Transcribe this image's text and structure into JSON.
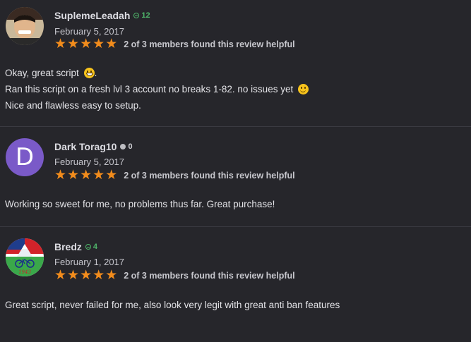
{
  "reviews": [
    {
      "username": "SuplemeLeadah",
      "rep": "12",
      "rep_type": "positive",
      "date": "February 5, 2017",
      "stars": 5,
      "helpful": "2 of 3 members found this review helpful",
      "avatar_letter": "",
      "body_lines": [
        "Okay, great script",
        "Ran this script on a fresh lvl 3 account no breaks 1-82. no issues yet",
        "Nice and flawless easy to setup."
      ]
    },
    {
      "username": "Dark Torag10",
      "rep": "0",
      "rep_type": "neutral",
      "date": "February 5, 2017",
      "stars": 5,
      "helpful": "2 of 3 members found this review helpful",
      "avatar_letter": "D",
      "body_lines": [
        "Working so sweet for me, no problems thus far. Great purchase!"
      ]
    },
    {
      "username": "Bredz",
      "rep": "4",
      "rep_type": "positive",
      "date": "February 1, 2017",
      "stars": 5,
      "helpful": "2 of 3 members found this review helpful",
      "avatar_letter": "",
      "body_lines": [
        "Great script, never failed for me, also look very legit with great anti ban features"
      ]
    }
  ],
  "colors": {
    "background": "#26262b",
    "star": "#f28c1c",
    "rep_positive": "#4fb56a",
    "avatar_d": "#7a5ac8"
  },
  "icons": [
    "star-icon",
    "reputation-icon",
    "grin-emoji-icon",
    "smile-emoji-icon"
  ]
}
